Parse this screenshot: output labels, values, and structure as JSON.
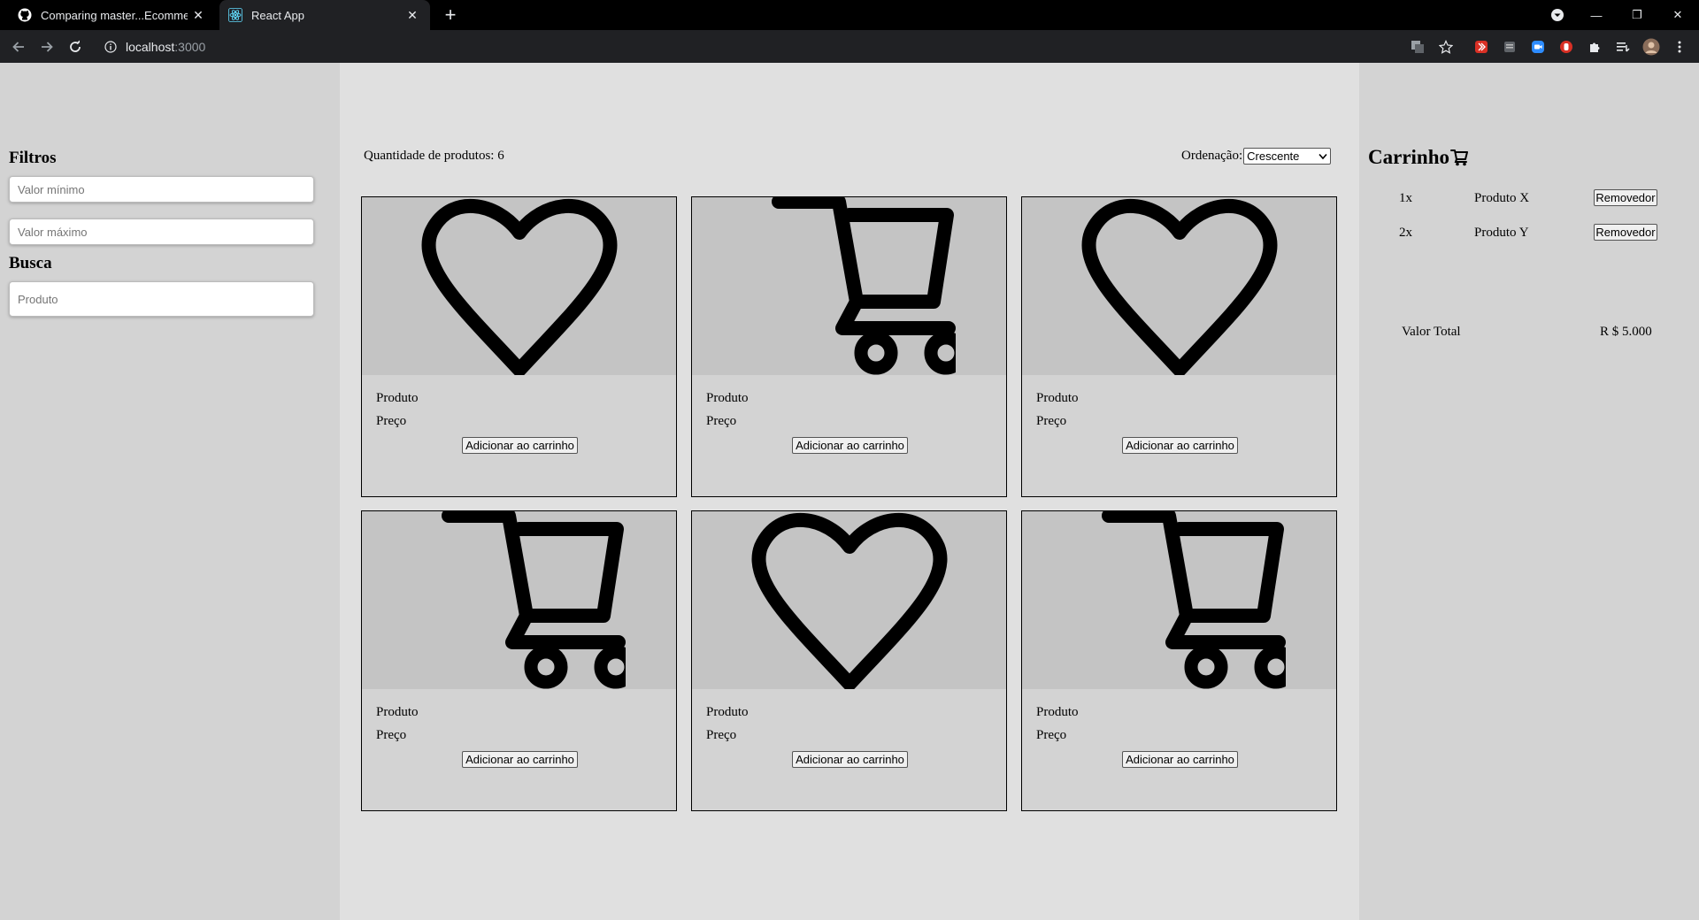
{
  "browser": {
    "tabs": [
      {
        "title": "Comparing master...Ecommerce-",
        "icon": "github-icon"
      },
      {
        "title": "React App",
        "icon": "react-icon"
      }
    ],
    "new_tab": "+",
    "url_host": "localhost",
    "url_port": ":3000",
    "window_controls": {
      "minimize": "—",
      "restore": "❐",
      "close": "✕"
    }
  },
  "filters": {
    "title": "Filtros",
    "min_placeholder": "Valor mínimo",
    "max_placeholder": "Valor máximo"
  },
  "search": {
    "title": "Busca",
    "placeholder": "Produto"
  },
  "products": {
    "count_label": "Quantidade de produtos: 6",
    "order_label": "Ordenação:",
    "order_value": "Crescente",
    "items": [
      {
        "image": "heart-icon",
        "name": "Produto",
        "price": "Preço",
        "button": "Adicionar ao carrinho"
      },
      {
        "image": "cart-icon",
        "name": "Produto",
        "price": "Preço",
        "button": "Adicionar ao carrinho"
      },
      {
        "image": "heart-icon",
        "name": "Produto",
        "price": "Preço",
        "button": "Adicionar ao carrinho"
      },
      {
        "image": "cart-icon",
        "name": "Produto",
        "price": "Preço",
        "button": "Adicionar ao carrinho"
      },
      {
        "image": "heart-icon",
        "name": "Produto",
        "price": "Preço",
        "button": "Adicionar ao carrinho"
      },
      {
        "image": "cart-icon",
        "name": "Produto",
        "price": "Preço",
        "button": "Adicionar ao carrinho"
      }
    ]
  },
  "cart": {
    "title": "Carrinho",
    "items": [
      {
        "qty": "1x",
        "name": "Produto X",
        "remove": "Removedor"
      },
      {
        "qty": "2x",
        "name": "Produto Y",
        "remove": "Removedor"
      }
    ],
    "total_label": "Valor Total",
    "total_value": "R $ 5.000"
  }
}
